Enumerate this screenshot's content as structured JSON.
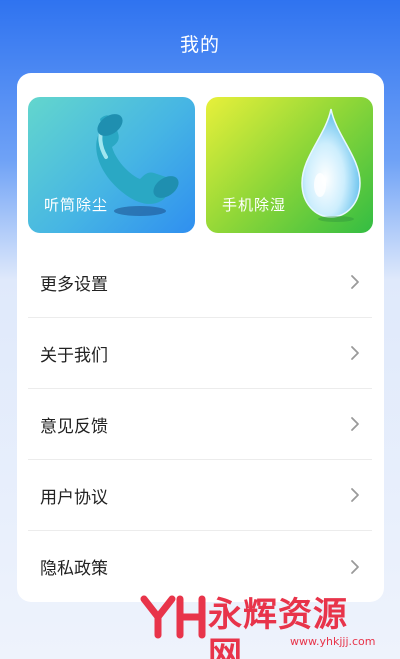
{
  "header": {
    "title": "我的"
  },
  "tiles": [
    {
      "label": "听筒除尘",
      "icon": "phone-receiver-icon"
    },
    {
      "label": "手机除湿",
      "icon": "water-drop-icon"
    }
  ],
  "menu": {
    "items": [
      {
        "label": "更多设置"
      },
      {
        "label": "关于我们"
      },
      {
        "label": "意见反馈"
      },
      {
        "label": "用户协议"
      },
      {
        "label": "隐私政策"
      }
    ]
  },
  "watermark": {
    "logo": "YH",
    "text": "永辉资源网",
    "url": "www.yhkjjj.com"
  },
  "colors": {
    "accent": "#2f73f0",
    "tile_left": "#46b5e4",
    "tile_right": "#8dd638",
    "watermark": "#e8344a"
  }
}
